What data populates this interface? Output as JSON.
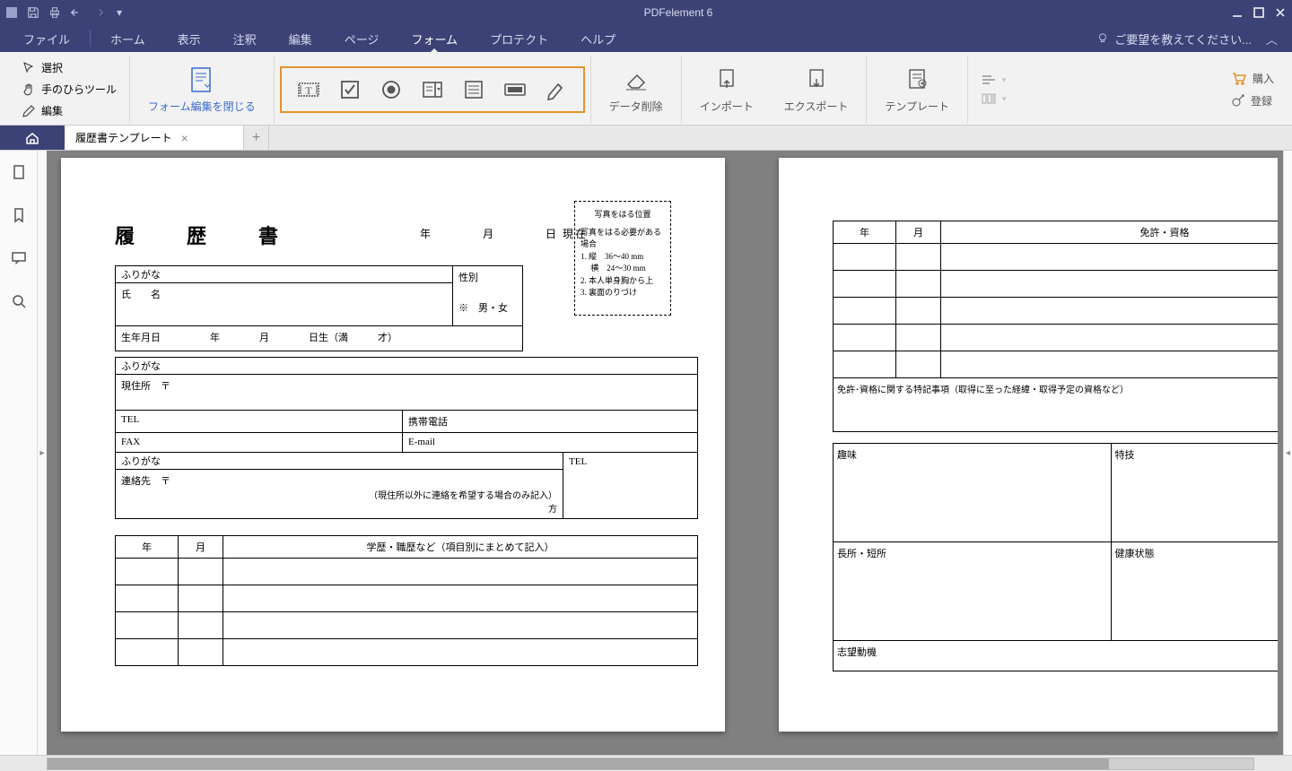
{
  "title_bar": {
    "app_title": "PDFelement 6"
  },
  "menu": {
    "file": "ファイル",
    "home": "ホーム",
    "view": "表示",
    "comment": "注釈",
    "edit": "編集",
    "page": "ページ",
    "form": "フォーム",
    "protect": "プロテクト",
    "help": "ヘルプ",
    "feedback": "ご要望を教えてください..."
  },
  "ribbon": {
    "select": "選択",
    "hand": "手のひらツール",
    "edit": "編集",
    "close_form_edit": "フォーム編集を閉じる",
    "clear_data": "データ削除",
    "import": "インポート",
    "export": "エクスポート",
    "template": "テンプレート",
    "buy": "購入",
    "register": "登録"
  },
  "tab": {
    "doc_name": "履歴書テンプレート"
  },
  "page1": {
    "title": "履　歴　書",
    "date_line": "年　　　　月　　　　日  現在",
    "furigana": "ふりがな",
    "name_label": "氏　　名",
    "gender_label": "性別",
    "gender_value": "※　男・女",
    "dob_label": "生年月日",
    "dob_value": "年　　　　月　　　　日生（満　　　才）",
    "address_label": "現住所　〒",
    "tel": "TEL",
    "mobile": "携帯電話",
    "fax": "FAX",
    "email": "E-mail",
    "contact_label": "連絡先　〒",
    "contact_note": "（現住所以外に連絡を希望する場合のみ記入）",
    "contact_suffix": "方",
    "contact_tel": "TEL",
    "hist_year": "年",
    "hist_month": "月",
    "hist_header": "学歴・職歴など（項目別にまとめて記入）",
    "photo": {
      "title": "写真をはる位置",
      "line1": "写真をはる必要がある場合",
      "line2": "1. 縦　36〜40 mm",
      "line3": "　 横　24〜30 mm",
      "line4": "2. 本人単身胸から上",
      "line5": "3. 裏面のりづけ"
    }
  },
  "page2": {
    "year": "年",
    "month": "月",
    "license_header": "免許・資格",
    "license_note": "免許･資格に関する特記事項（取得に至った経緯・取得予定の資格など）",
    "hobby": "趣味",
    "skill": "特技",
    "strength": "長所・短所",
    "health": "健康状態",
    "motive": "志望動機"
  }
}
